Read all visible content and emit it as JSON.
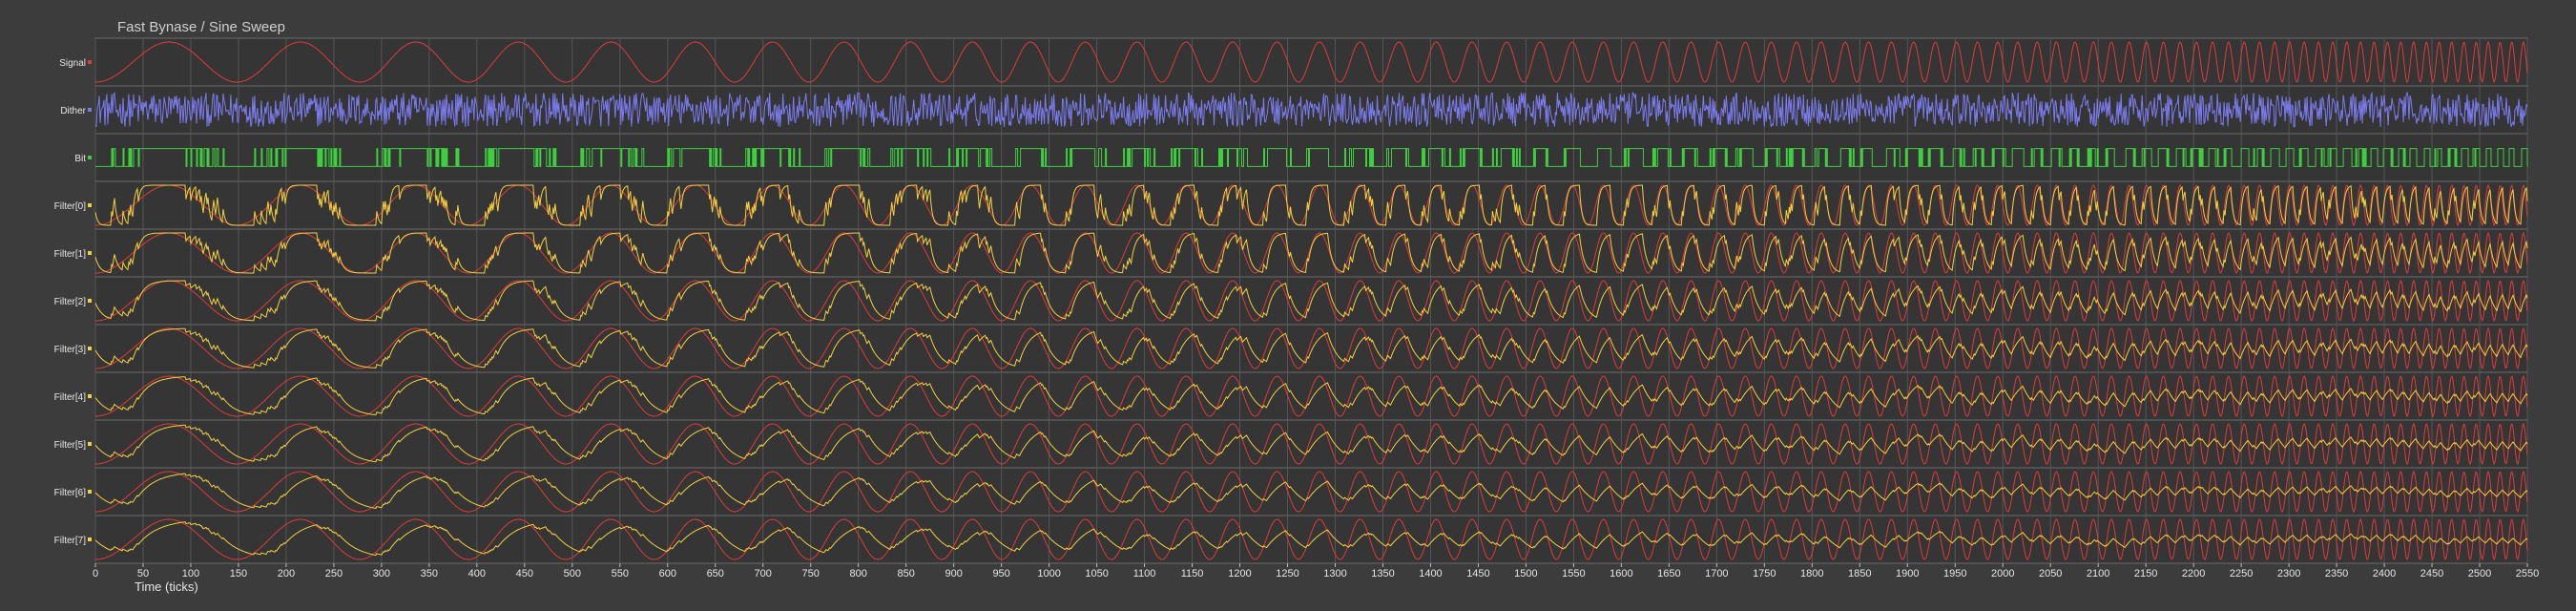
{
  "chart_data": {
    "type": "line",
    "title": "Fast Bynase / Sine Sweep",
    "xlabel": "Time (ticks)",
    "ylabel": "",
    "xlim": [
      0,
      2550
    ],
    "xticks": [
      0,
      50,
      100,
      150,
      200,
      250,
      300,
      350,
      400,
      450,
      500,
      550,
      600,
      650,
      700,
      750,
      800,
      850,
      900,
      950,
      1000,
      1050,
      1100,
      1150,
      1200,
      1250,
      1300,
      1350,
      1400,
      1450,
      1500,
      1550,
      1600,
      1650,
      1700,
      1750,
      1800,
      1850,
      1900,
      1950,
      2000,
      2050,
      2100,
      2150,
      2200,
      2250,
      2300,
      2350,
      2400,
      2450,
      2500,
      2550
    ],
    "grid": true,
    "layout": "stacked panels, shared x axis",
    "sweep": {
      "start_period_ticks": 160,
      "end_period_ticks": 12,
      "amplitude_range": [
        -1,
        1
      ]
    },
    "series": [
      {
        "name": "Signal",
        "color": "#e03a3a",
        "kind": "sine sweep"
      },
      {
        "name": "Dither",
        "color": "#7b7bee",
        "kind": "random noise"
      },
      {
        "name": "Bit",
        "color": "#3ecf3e",
        "kind": "1-bit output (0/1)"
      },
      {
        "name": "Filter[0]",
        "color": "#f2d040",
        "kind": "filtered bit stream"
      },
      {
        "name": "Filter[1]",
        "color": "#f2d040",
        "kind": "filtered bit stream"
      },
      {
        "name": "Filter[2]",
        "color": "#f2d040",
        "kind": "filtered bit stream"
      },
      {
        "name": "Filter[3]",
        "color": "#f2d040",
        "kind": "filtered bit stream"
      },
      {
        "name": "Filter[4]",
        "color": "#f2d040",
        "kind": "filtered bit stream"
      },
      {
        "name": "Filter[5]",
        "color": "#f2d040",
        "kind": "filtered bit stream"
      },
      {
        "name": "Filter[6]",
        "color": "#f2d040",
        "kind": "filtered bit stream"
      },
      {
        "name": "Filter[7]",
        "color": "#f2d040",
        "kind": "filtered bit stream"
      }
    ],
    "overlay": {
      "series": "Signal",
      "on": [
        "Filter[0]",
        "Filter[1]",
        "Filter[2]",
        "Filter[3]",
        "Filter[4]",
        "Filter[5]",
        "Filter[6]",
        "Filter[7]"
      ]
    },
    "colors": {
      "background": "#3c3c3c",
      "panel": "#353535",
      "grid": "#6a6a6a",
      "text": "#e6e6e6"
    }
  }
}
